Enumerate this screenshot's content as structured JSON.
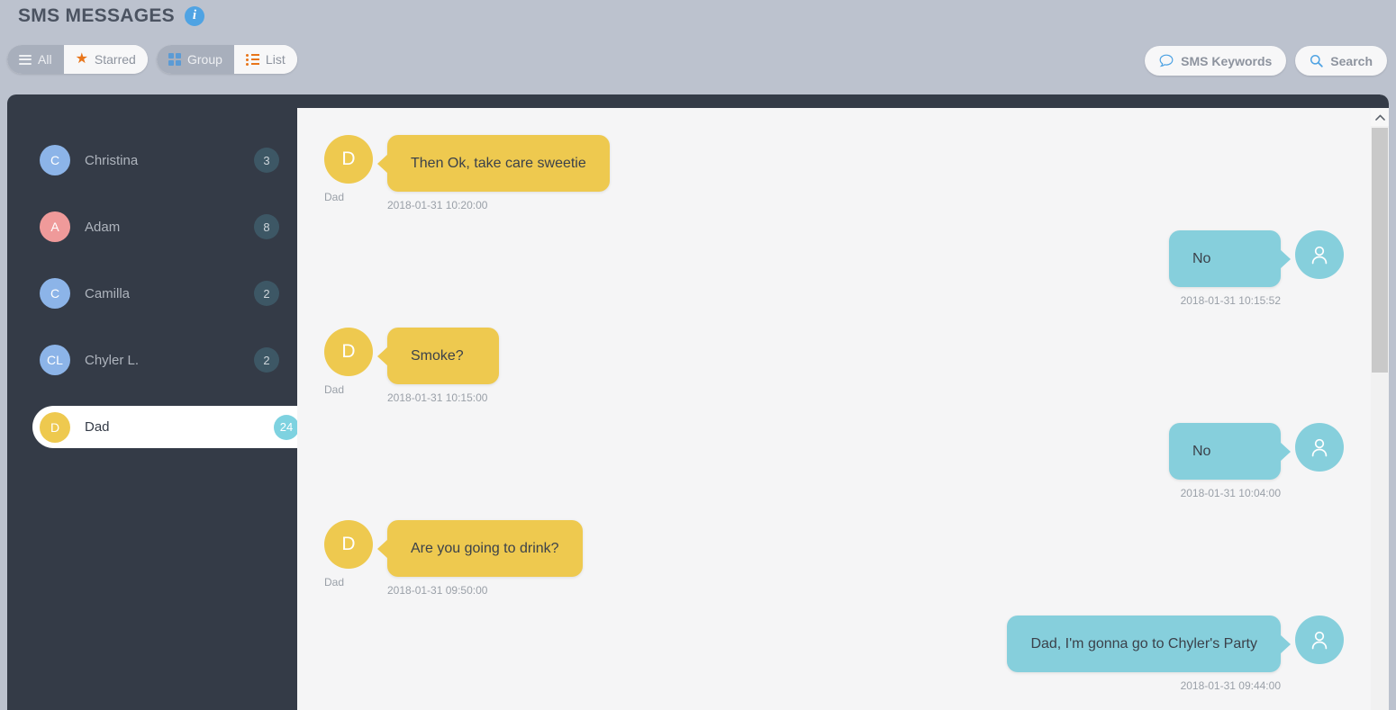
{
  "header": {
    "title": "SMS MESSAGES",
    "info_icon": "info-icon",
    "filter_tabs": [
      {
        "label": "All",
        "icon": "hamburger-icon",
        "active": true
      },
      {
        "label": "Starred",
        "icon": "star-icon",
        "active": false
      }
    ],
    "view_tabs": [
      {
        "label": "Group",
        "icon": "grid-icon",
        "active": true
      },
      {
        "label": "List",
        "icon": "list-icon",
        "active": false
      }
    ],
    "actions": [
      {
        "label": "SMS Keywords",
        "icon": "chat-bubble-icon"
      },
      {
        "label": "Search",
        "icon": "search-icon"
      }
    ]
  },
  "sidebar": {
    "contacts": [
      {
        "initials": "C",
        "name": "Christina",
        "count": "3",
        "color": "#8cb4e8",
        "selected": false
      },
      {
        "initials": "A",
        "name": "Adam",
        "count": "8",
        "color": "#ef9a9a",
        "selected": false
      },
      {
        "initials": "C",
        "name": "Camilla",
        "count": "2",
        "color": "#8cb4e8",
        "selected": false
      },
      {
        "initials": "CL",
        "name": "Chyler L.",
        "count": "2",
        "color": "#8cb4e8",
        "selected": false
      },
      {
        "initials": "D",
        "name": "Dad",
        "count": "24",
        "color": "#eec94f",
        "selected": true
      }
    ]
  },
  "chat": {
    "messages": [
      {
        "direction": "in",
        "text": "Then Ok, take care sweetie",
        "timestamp": "2018-01-31 10:20:00",
        "sender": "Dad",
        "initials": "D",
        "avatar_color": "#eec94f"
      },
      {
        "direction": "out",
        "text": "No",
        "timestamp": "2018-01-31 10:15:52",
        "sender": "",
        "initials": "",
        "avatar_color": "#86cfdc"
      },
      {
        "direction": "in",
        "text": "Smoke?",
        "timestamp": "2018-01-31 10:15:00",
        "sender": "Dad",
        "initials": "D",
        "avatar_color": "#eec94f"
      },
      {
        "direction": "out",
        "text": "No",
        "timestamp": "2018-01-31 10:04:00",
        "sender": "",
        "initials": "",
        "avatar_color": "#86cfdc"
      },
      {
        "direction": "in",
        "text": "Are you going to drink?",
        "timestamp": "2018-01-31 09:50:00",
        "sender": "Dad",
        "initials": "D",
        "avatar_color": "#eec94f"
      },
      {
        "direction": "out",
        "text": "Dad, I'm gonna go to Chyler's Party",
        "timestamp": "2018-01-31 09:44:00",
        "sender": "",
        "initials": "",
        "avatar_color": "#86cfdc"
      }
    ]
  },
  "colors": {
    "header_bg": "#bcc2ce",
    "sidebar_bg": "#343b47",
    "chat_bg": "#f5f5f6",
    "incoming_bubble": "#eec94f",
    "outgoing_bubble": "#86cfdc",
    "accent_blue": "#4fa3e3",
    "star_orange": "#e8751a"
  }
}
